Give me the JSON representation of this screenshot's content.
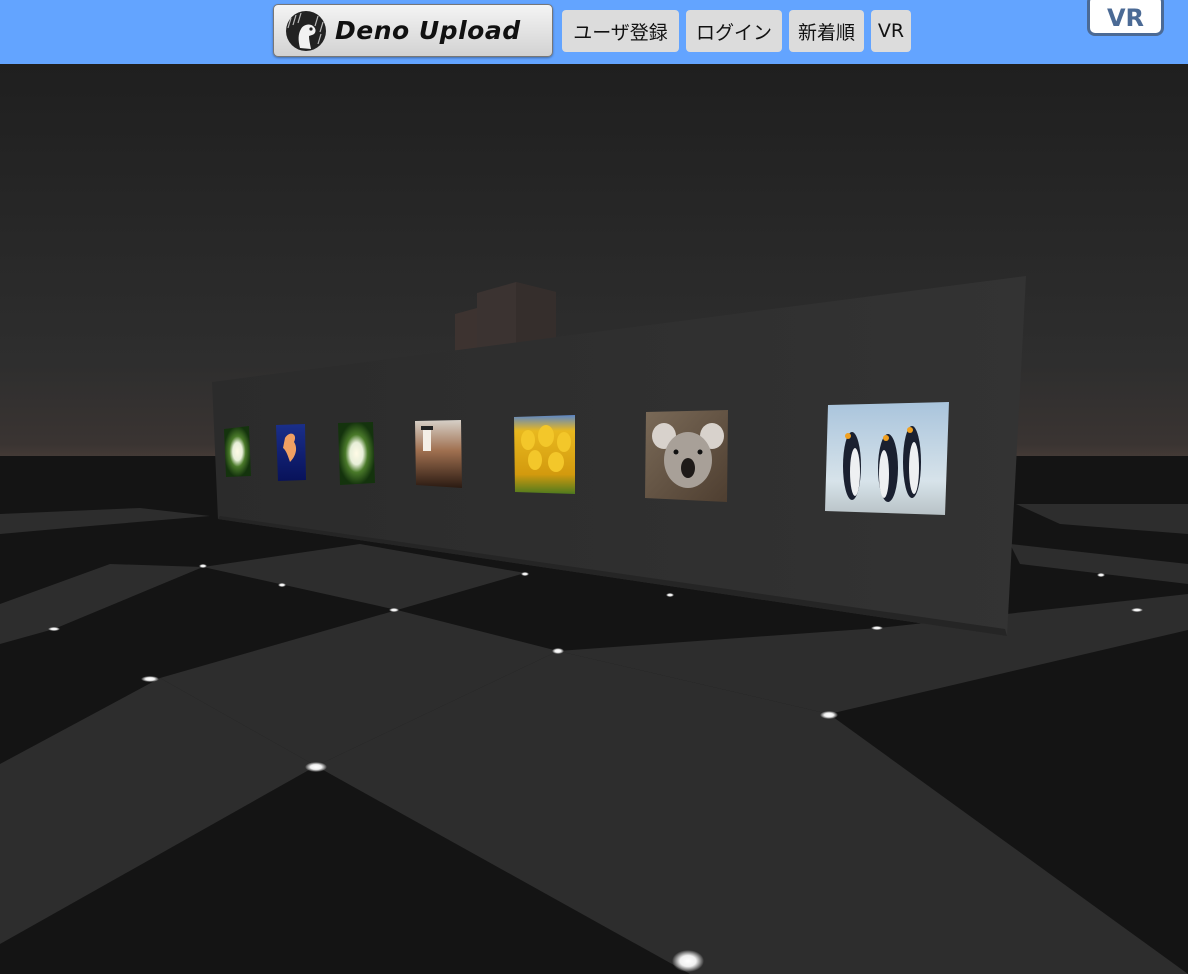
{
  "header": {
    "logo_label": "Deno Upload",
    "nav": {
      "register": "ユーザ登録",
      "login": "ログイン",
      "newest": "新着順",
      "vr": "VR"
    },
    "enter_vr": "VR"
  },
  "colors": {
    "header_bg": "#63a4ff",
    "nav_button_bg": "#dcdcdc",
    "vr_button_border": "#4b6a95",
    "floor_dark": "#111111",
    "floor_light": "#2d2d2d",
    "gallery_wall": "#2f2f2f"
  },
  "gallery": {
    "photos": [
      {
        "subject": "white flower",
        "icon": "flower-photo"
      },
      {
        "subject": "jellyfish",
        "icon": "jellyfish-photo"
      },
      {
        "subject": "white flower",
        "icon": "flower-photo"
      },
      {
        "subject": "lighthouse",
        "icon": "lighthouse-photo"
      },
      {
        "subject": "tulips",
        "icon": "tulips-photo"
      },
      {
        "subject": "koala",
        "icon": "koala-photo"
      },
      {
        "subject": "penguins",
        "icon": "penguins-photo"
      }
    ]
  }
}
